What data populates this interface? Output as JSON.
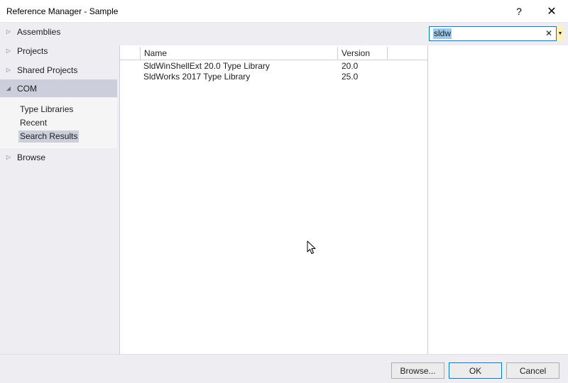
{
  "window": {
    "title": "Reference Manager - Sample",
    "help_glyph": "?",
    "close_glyph": "✕"
  },
  "sidebar": {
    "items": [
      {
        "label": "Assemblies",
        "arrow": "▷"
      },
      {
        "label": "Projects",
        "arrow": "▷"
      },
      {
        "label": "Shared Projects",
        "arrow": "▷"
      },
      {
        "label": "COM",
        "arrow": "◢"
      },
      {
        "label": "Browse",
        "arrow": "▷"
      }
    ],
    "com_subitems": [
      "Type Libraries",
      "Recent",
      "Search Results"
    ],
    "selected_subitem": "Search Results"
  },
  "search": {
    "value": "sldw",
    "clear_glyph": "✕",
    "dropdown_glyph": "▼"
  },
  "list": {
    "columns": [
      "Name",
      "Version"
    ],
    "rows": [
      {
        "name": "SldWinShellExt 20.0 Type Library",
        "version": "20.0"
      },
      {
        "name": "SldWorks 2017 Type Library",
        "version": "25.0"
      }
    ]
  },
  "buttons": {
    "browse": "Browse...",
    "ok": "OK",
    "cancel": "Cancel"
  },
  "colors": {
    "accent": "#007acc",
    "sidebar_bg": "#eeeef2",
    "selection": "#cccedb",
    "search_highlight": "#99c9ef"
  }
}
